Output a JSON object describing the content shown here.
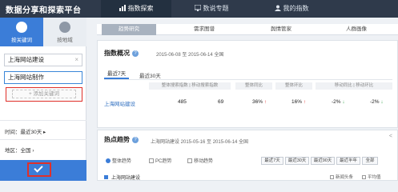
{
  "brand": "数据分享和探索平台",
  "nav": [
    {
      "label": "指数探索",
      "active": true
    },
    {
      "label": "数说专题",
      "active": false
    },
    {
      "label": "我的指数",
      "active": false
    }
  ],
  "sidebar": {
    "tabs": [
      {
        "label": "按关键词",
        "active": true
      },
      {
        "label": "按地域",
        "active": false
      }
    ],
    "keywords": [
      "上海网站建设",
      "上海网站制作"
    ],
    "keyword_close": "×",
    "add_keyword": "+ 添加关键词",
    "time_label": "时间：最近30天",
    "region_label": "地区：全国"
  },
  "main": {
    "subtabs": [
      "趋势研究",
      "需求图谱",
      "舆情管家",
      "人群画像"
    ],
    "overview": {
      "title": "指数概况",
      "date": "2015-06-08 至 2015-06-14  全国",
      "tabs": [
        "最近7天",
        "最近30天"
      ],
      "headers": [
        "整体搜索指数 | 移动搜索指数",
        "整体同比",
        "整体环比",
        "移动同比 | 移动环比"
      ],
      "row": {
        "keyword": "上海网站建设",
        "overall": "485",
        "mobile": "69",
        "overall_yoy": "36%",
        "overall_mom": "16%",
        "mobile_yoy": "-2%",
        "mobile_mom": "-2%"
      }
    },
    "trend": {
      "title": "热点趋势",
      "date": "上海网站建设  2015-05-16 至 2015-06-14  全国",
      "tabs": [
        "整体趋势",
        "PC趋势",
        "移动趋势"
      ],
      "ranges": [
        "最近7天",
        "最近30天",
        "最近90天",
        "最近半年",
        "全部"
      ],
      "legend": "上海网站建设",
      "options": [
        "新闻头条",
        "平均值"
      ],
      "share": "<"
    }
  }
}
